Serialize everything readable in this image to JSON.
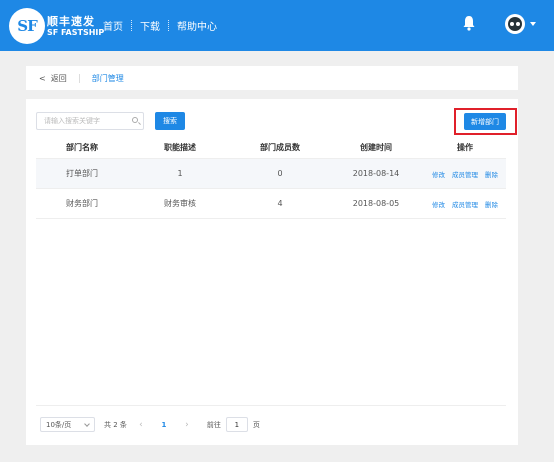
{
  "header": {
    "logo_text": "SF",
    "brand_cn": "顺丰速发",
    "brand_en": "SF FASTSHIP",
    "nav": [
      "首页",
      "下载",
      "帮助中心"
    ],
    "icons": [
      "bell-icon",
      "avatar",
      "caret-down-icon"
    ],
    "color": "#1e88e5"
  },
  "breadcrumb": {
    "back": "返回",
    "current": "部门管理"
  },
  "search": {
    "placeholder": "请输入搜索关键字",
    "value": "",
    "button": "搜索"
  },
  "add_button": "新增部门",
  "highlight_color": "#e0202a",
  "table": {
    "headers": [
      "部门名称",
      "职能描述",
      "部门成员数",
      "创建时间",
      "操作"
    ],
    "rows": [
      {
        "name": "打单部门",
        "desc": "1",
        "members": "0",
        "created": "2018-08-14",
        "ops": [
          "修改",
          "成员管理",
          "删除"
        ]
      },
      {
        "name": "财务部门",
        "desc": "财务审核",
        "members": "4",
        "created": "2018-08-05",
        "ops": [
          "修改",
          "成员管理",
          "删除"
        ]
      }
    ]
  },
  "pagination": {
    "page_size": "10条/页",
    "total": "共 2 条",
    "current_page": "1",
    "goto_label": "前往",
    "goto_value": "1",
    "goto_suffix": "页"
  }
}
